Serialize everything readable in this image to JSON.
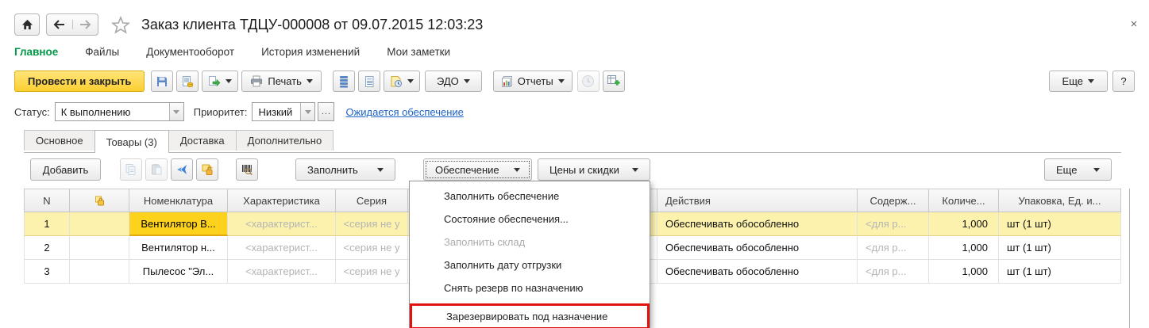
{
  "window": {
    "close_label": "×"
  },
  "header": {
    "title": "Заказ клиента ТДЦУ-000008 от 09.07.2015 12:03:23"
  },
  "sections": {
    "items": [
      {
        "label": "Главное"
      },
      {
        "label": "Файлы"
      },
      {
        "label": "Документооборот"
      },
      {
        "label": "История изменений"
      },
      {
        "label": "Мои заметки"
      }
    ]
  },
  "toolbar": {
    "post_close": "Провести и закрыть",
    "print": "Печать",
    "edo": "ЭДО",
    "reports": "Отчеты",
    "more": "Еще",
    "help": "?"
  },
  "status_bar": {
    "status_label": "Статус:",
    "status_value": "К выполнению",
    "priority_label": "Приоритет:",
    "priority_value": "Низкий",
    "ellipsis": "...",
    "link": "Ожидается обеспечение"
  },
  "tabs": {
    "items": [
      {
        "label": "Основное"
      },
      {
        "label": "Товары (3)"
      },
      {
        "label": "Доставка"
      },
      {
        "label": "Дополнительно"
      }
    ]
  },
  "table_toolbar": {
    "add": "Добавить",
    "fill": "Заполнить",
    "supply": "Обеспечение",
    "prices": "Цены и скидки",
    "more": "Еще"
  },
  "table": {
    "columns": {
      "n": "N",
      "nomenclature": "Номенклатура",
      "characteristic": "Характеристика",
      "series": "Серия",
      "actions": "Действия",
      "content": "Содерж...",
      "quantity": "Количе...",
      "package": "Упаковка, Ед. и..."
    },
    "rows": [
      {
        "n": "1",
        "nomenclature": "Вентилятор В...",
        "characteristic": "<характерист...",
        "series": "<серия не у",
        "actions": "Обеспечивать обособленно",
        "content": "<для р...",
        "quantity": "1,000",
        "package": "шт (1 шт)"
      },
      {
        "n": "2",
        "nomenclature": "Вентилятор н...",
        "characteristic": "<характерист...",
        "series": "<серия не у",
        "actions": "Обеспечивать обособленно",
        "content": "<для р...",
        "quantity": "1,000",
        "package": "шт (1 шт)"
      },
      {
        "n": "3",
        "nomenclature": "Пылесос \"Эл...",
        "characteristic": "<характерист...",
        "series": "<серия не у",
        "actions": "Обеспечивать обособленно",
        "content": "<для р...",
        "quantity": "1,000",
        "package": "шт (1 шт)"
      }
    ]
  },
  "menu": {
    "items": [
      {
        "label": "Заполнить обеспечение"
      },
      {
        "label": "Состояние обеспечения..."
      },
      {
        "label": "Заполнить склад"
      },
      {
        "label": "Заполнить дату отгрузки"
      },
      {
        "label": "Снять резерв по назначению"
      },
      {
        "label": "Зарезервировать под назначение"
      }
    ]
  },
  "colors": {
    "accent_yellow": "#fcd11c",
    "brand_green": "#009845",
    "link_blue": "#1d64c8",
    "highlight_red": "#e01310",
    "selection_yellow": "#fcf2ad"
  }
}
